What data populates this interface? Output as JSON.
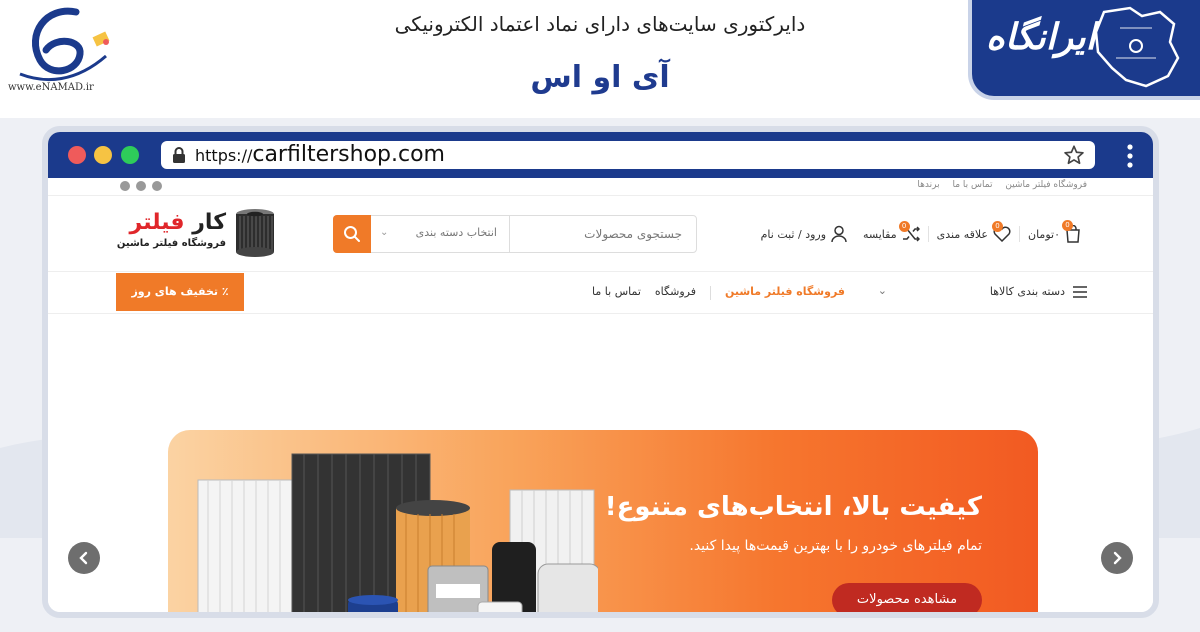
{
  "directory": {
    "enamad_url": "www.eNAMAD.ir",
    "title": "دایرکتوری سایت‌های دارای نماد اعتماد الکترونیکی",
    "site_name": "آی او اس",
    "brand_logo_text": "ایرانگاه"
  },
  "browser": {
    "url_protocol": "https://",
    "url_domain": "carfiltershop.com"
  },
  "site": {
    "topstrip_links": [
      "فروشگاه فیلتر ماشین",
      "تماس با ما",
      "برندها"
    ],
    "brand": {
      "name_part1": "کار",
      "name_part2": "فیلتر",
      "tagline": "فروشگاه فیلتر ماشین"
    },
    "search": {
      "placeholder": "جستجوی محصولات",
      "category_label": "انتخاب دسته بندی"
    },
    "header_actions": {
      "cart_label": "۰تومان",
      "cart_count": "0",
      "wishlist_label": "علاقه مندی",
      "wishlist_count": "0",
      "compare_label": "مقایسه",
      "compare_count": "0",
      "account_label": "ورود / ثبت نام"
    },
    "nav": {
      "categories_label": "دسته بندی کالاها",
      "links": [
        "فروشگاه فیلتر ماشین",
        "فروشگاه",
        "تماس با ما"
      ],
      "deal_button": "٪ تخفیف های روز"
    },
    "hero": {
      "title": "کیفیت بالا، انتخاب‌های متنوع!",
      "subtitle": "تمام فیلترهای خودرو را با بهترین قیمت‌ها پیدا کنید.",
      "cta": "مشاهده محصولات"
    }
  },
  "colors": {
    "header_blue": "#1b3a8c",
    "accent_orange": "#f07a28",
    "cta_red": "#c02a21"
  }
}
